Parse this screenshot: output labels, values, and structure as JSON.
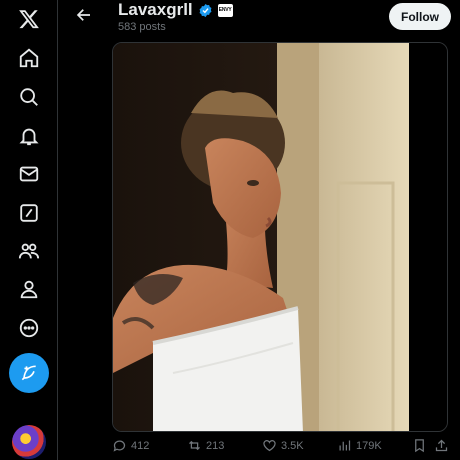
{
  "header": {
    "title": "Lavaxgrll",
    "affiliate_badge": "ENVY",
    "posts_count": "583 posts",
    "follow_label": "Follow"
  },
  "nav": {
    "items": [
      "x-logo-icon",
      "home-icon",
      "explore-icon",
      "notifications-icon",
      "messages-icon",
      "grok-icon",
      "communities-icon",
      "profile-icon",
      "more-icon"
    ]
  },
  "actions": {
    "replies": "412",
    "reposts": "213",
    "likes": "3.5K",
    "views": "179K"
  },
  "colors": {
    "accent": "#1d9bf0",
    "background": "#000000",
    "muted": "#71767b"
  }
}
